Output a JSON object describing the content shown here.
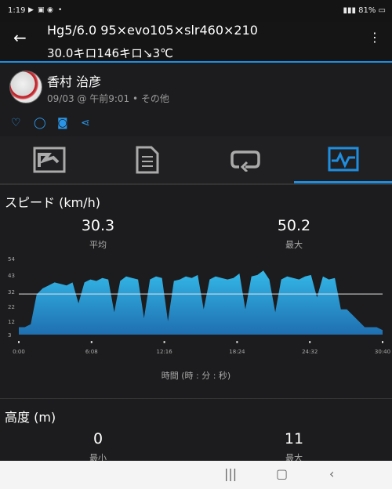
{
  "status": {
    "time": "1:19",
    "battery": "81%"
  },
  "header": {
    "title": "Hg5/6.0 95×evo105×slr460×210",
    "subtitle": "30.0キロ146キロ↘3℃"
  },
  "user": {
    "name": "香村 治彦",
    "meta": "09/03 @ 午前9:01 • その他"
  },
  "speed": {
    "title": "スピード (km/h)",
    "avg_value": "30.3",
    "avg_label": "平均",
    "max_value": "50.2",
    "max_label": "最大"
  },
  "elevation": {
    "title": "高度 (m)",
    "min_value": "0",
    "min_label": "最小",
    "max_value": "11",
    "max_label": "最大"
  },
  "chart_data": {
    "type": "area",
    "ylabel": "",
    "xlabel": "時間 (時 : 分 : 秒)",
    "ylim": [
      3,
      54
    ],
    "yticks": [
      "54",
      "43",
      "32",
      "22",
      "12",
      "3"
    ],
    "xticks": [
      "0:00",
      "6:08",
      "12:16",
      "18:24",
      "24:32",
      "30:40"
    ],
    "avg_line": 30.3,
    "x": [
      0,
      0.5,
      1,
      1.5,
      2,
      2.5,
      3,
      3.5,
      4,
      4.5,
      5,
      5.5,
      6,
      6.5,
      7,
      7.5,
      8,
      8.5,
      9,
      9.5,
      10,
      10.5,
      11,
      11.5,
      12,
      12.5,
      13,
      13.5,
      14,
      14.5,
      15,
      15.5,
      16,
      16.5,
      17,
      17.5,
      18,
      18.5,
      19,
      19.5,
      20,
      20.5,
      21,
      21.5,
      22,
      22.5,
      23,
      23.5,
      24,
      24.5,
      25,
      25.5,
      26,
      26.5,
      27,
      27.5,
      28,
      28.5,
      29,
      29.5,
      30,
      30.5
    ],
    "values": [
      8,
      8,
      10,
      30,
      34,
      36,
      38,
      37,
      36,
      38,
      24,
      38,
      40,
      39,
      41,
      40,
      18,
      39,
      42,
      41,
      40,
      14,
      40,
      42,
      41,
      12,
      39,
      40,
      42,
      41,
      43,
      20,
      40,
      42,
      41,
      40,
      41,
      44,
      20,
      42,
      43,
      46,
      40,
      18,
      40,
      42,
      41,
      40,
      42,
      43,
      28,
      42,
      40,
      41,
      20,
      20,
      16,
      12,
      8,
      8,
      8,
      6
    ]
  },
  "colors": {
    "accent": "#1f8ee0",
    "chart_fill_top": "#34b8e8",
    "chart_fill_bottom": "#1f6fb0"
  }
}
